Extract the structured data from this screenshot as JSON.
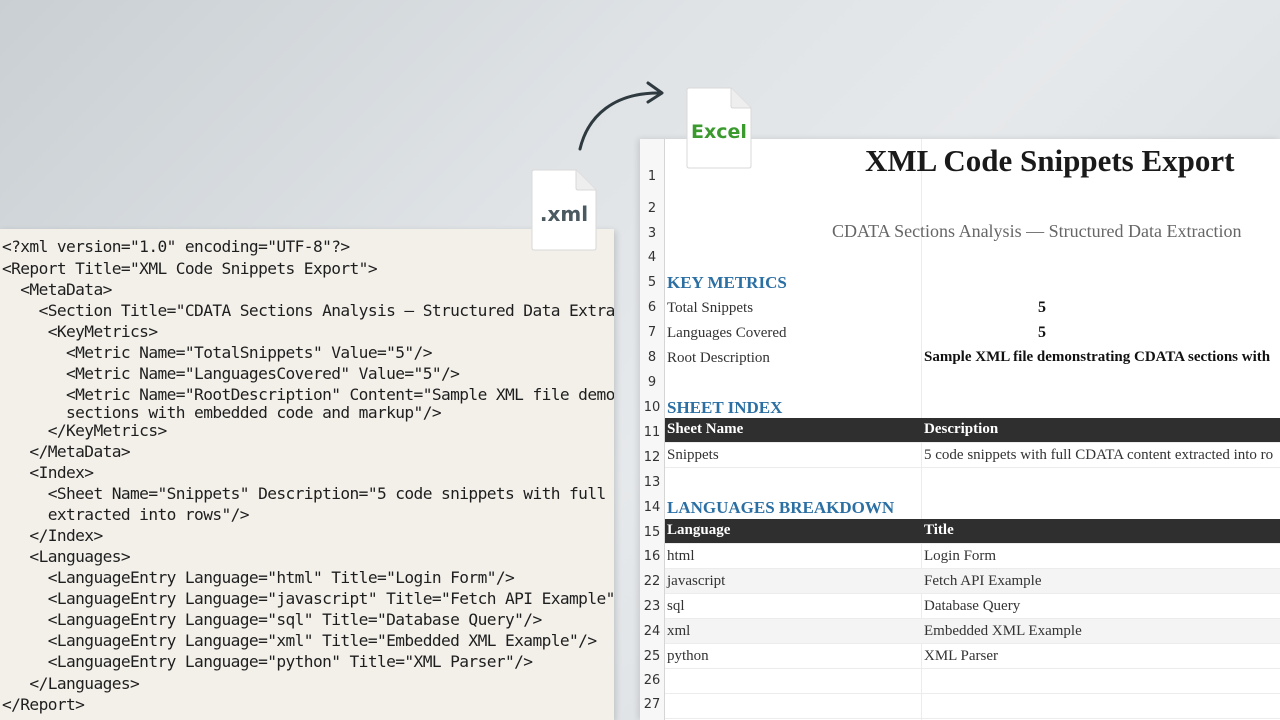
{
  "xml_code": {
    "lines": [
      "<?xml version=\"1.0\" encoding=\"UTF-8\"?>",
      "<Report Title=\"XML Code Snippets Export\">",
      "  <MetaData>",
      "    <Section Title=\"CDATA Sections Analysis — Structured Data Extra",
      "     <KeyMetrics>",
      "       <Metric Name=\"TotalSnippets\" Value=\"5\"/>",
      "       <Metric Name=\"LanguagesCovered\" Value=\"5\"/>",
      "       <Metric Name=\"RootDescription\" Content=\"Sample XML file demo",
      "       sections with embedded code and markup\"/>",
      "     </KeyMetrics>",
      "   </MetaData>",
      "   <Index>",
      "     <Sheet Name=\"Snippets\" Description=\"5 code snippets with full",
      "     extracted into rows\"/>",
      "   </Index>",
      "   <Languages>",
      "     <LanguageEntry Language=\"html\" Title=\"Login Form\"/>",
      "     <LanguageEntry Language=\"javascript\" Title=\"Fetch API Example\"",
      "     <LanguageEntry Language=\"sql\" Title=\"Database Query\"/>",
      "     <LanguageEntry Language=\"xml\" Title=\"Embedded XML Example\"/>",
      "     <LanguageEntry Language=\"python\" Title=\"XML Parser\"/>",
      "   </Languages>",
      "</Report>"
    ]
  },
  "icons": {
    "xml_file_label": ".xml",
    "excel_file_label": "Excel",
    "excel_color": "#3a9a2e",
    "xml_color": "#4a5a60"
  },
  "sheet": {
    "title": "XML Code Snippets Export",
    "subtitle": "CDATA Sections Analysis — Structured Data Extraction",
    "key_metrics_heading": "KEY METRICS",
    "metrics": [
      {
        "label": "Total Snippets",
        "value": "5"
      },
      {
        "label": "Languages Covered",
        "value": "5"
      },
      {
        "label": "Root Description",
        "value": "Sample XML file demonstrating CDATA sections with"
      }
    ],
    "sheet_index_heading": "SHEET INDEX",
    "index_headers": {
      "name": "Sheet Name",
      "description": "Description"
    },
    "index_rows": [
      {
        "name": "Snippets",
        "description": "5 code snippets with full CDATA content extracted into ro"
      }
    ],
    "languages_heading": "LANGUAGES BREAKDOWN",
    "languages_headers": {
      "language": "Language",
      "title": "Title"
    },
    "languages": [
      {
        "language": "html",
        "title": "Login Form"
      },
      {
        "language": "javascript",
        "title": "Fetch API Example"
      },
      {
        "language": "sql",
        "title": "Database Query"
      },
      {
        "language": "xml",
        "title": "Embedded XML Example"
      },
      {
        "language": "python",
        "title": "XML Parser"
      }
    ],
    "row_numbers": [
      "1",
      "2",
      "3",
      "4",
      "5",
      "6",
      "7",
      "8",
      "9",
      "10",
      "11",
      "12",
      "13",
      "14",
      "15",
      "16",
      "22",
      "23",
      "24",
      "25",
      "26",
      "27"
    ],
    "header_color": "#2f2f2f",
    "section_color": "#2b6fa3"
  }
}
